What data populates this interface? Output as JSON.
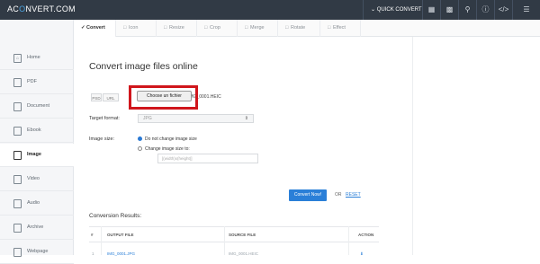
{
  "header": {
    "logo_left": "AC",
    "logo_right": "NVERT.COM",
    "quick_convert": "QUICK CONVERT",
    "icons": [
      "chevron-down-icon",
      "grid-icon",
      "layers-icon",
      "search-icon",
      "help-icon",
      "code-icon"
    ]
  },
  "tabs": [
    {
      "label": "Convert",
      "active": true
    },
    {
      "label": "Icon",
      "active": false
    },
    {
      "label": "Resize",
      "active": false
    },
    {
      "label": "Crop",
      "active": false
    },
    {
      "label": "Merge",
      "active": false
    },
    {
      "label": "Rotate",
      "active": false
    },
    {
      "label": "Effect",
      "active": false
    }
  ],
  "sidebar": {
    "items": [
      {
        "label": "Home",
        "icon": "home-icon"
      },
      {
        "label": "PDF",
        "icon": "pdf-icon"
      },
      {
        "label": "Document",
        "icon": "document-icon"
      },
      {
        "label": "Ebook",
        "icon": "ebook-icon"
      },
      {
        "label": "Image",
        "icon": "image-icon",
        "active": true
      },
      {
        "label": "Video",
        "icon": "video-icon"
      },
      {
        "label": "Audio",
        "icon": "audio-icon"
      },
      {
        "label": "Archive",
        "icon": "archive-icon"
      },
      {
        "label": "Webpage",
        "icon": "webpage-icon"
      }
    ]
  },
  "main": {
    "title": "Convert image files online",
    "source_buttons": [
      "PSD",
      "URL"
    ],
    "choose_label": "Choose un fichier",
    "file_name": "IMG_0001.HEIC",
    "target_format_label": "Target format:",
    "target_format_value": "JPG",
    "image_size_label": "Image size:",
    "size_option_1": "Do not change image size",
    "size_option_2": "Change image size to:",
    "size_placeholder": "[(width)x(height)]",
    "convert_label": "Convert Now!",
    "or_label": "OR",
    "reset_label": "RESET",
    "results_title": "Conversion Results:",
    "table_headers": [
      "#",
      "OUTPUT FILE",
      "SOURCE FILE",
      "ACTION"
    ],
    "row": {
      "num": "1",
      "output": "IMG_0001.JPG",
      "source": "IMG_0001.HEIC"
    }
  }
}
